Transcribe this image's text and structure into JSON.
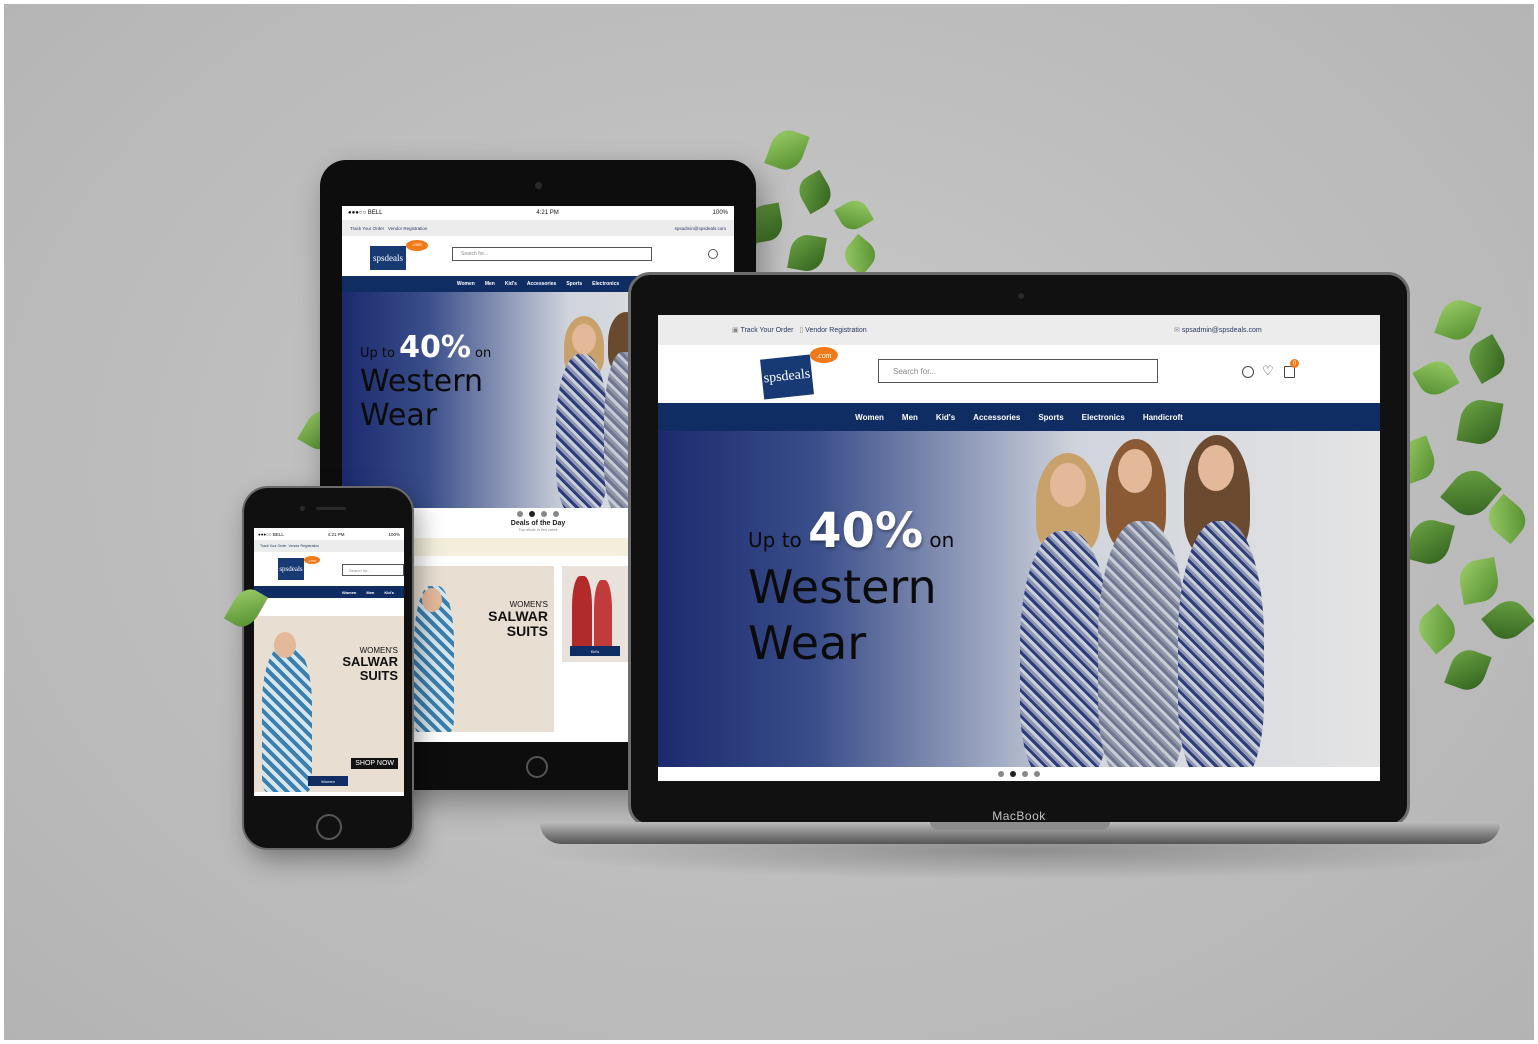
{
  "brand": {
    "name": "spsdeals",
    "suffix": ".com"
  },
  "topbar": {
    "track_order": "Track Your Order",
    "vendor_registration": "Vendor Registration",
    "email": "spsadmin@spsdeals.com",
    "email_short": "spsadmin@spsdeals.com"
  },
  "search": {
    "placeholder": "Search for..."
  },
  "cart": {
    "count": "0"
  },
  "nav": {
    "items": [
      "Women",
      "Men",
      "Kid's",
      "Accessories",
      "Sports",
      "Electronics",
      "Handicroft"
    ]
  },
  "hero": {
    "prefix": "Up to",
    "percent": "40%",
    "on": "on",
    "line1": "Western",
    "line2": "Wear"
  },
  "tablet": {
    "status": {
      "carrier": "●●●○○ BELL",
      "time": "4:21 PM",
      "battery": "100%"
    },
    "deals_title": "Deals of the Day",
    "deals_subtitle": "Top deals in this week",
    "salwar": {
      "line1": "WOMEN'S",
      "line2": "SALWAR",
      "line3": "SUITS"
    },
    "kids_label": "Kid's"
  },
  "phone": {
    "status": {
      "carrier": "●●●○○ BELL",
      "time": "4:21 PM",
      "battery": "100%"
    },
    "salwar": {
      "line1": "WOMEN'S",
      "line2": "SALWAR",
      "line3": "SUITS"
    },
    "shop_now": "SHOP NOW",
    "women_label": "Women"
  },
  "laptop": {
    "brand_label": "MacBook"
  },
  "colors": {
    "nav": "#0f2d63",
    "accent": "#f07a1a",
    "topbar": "#ececec"
  }
}
